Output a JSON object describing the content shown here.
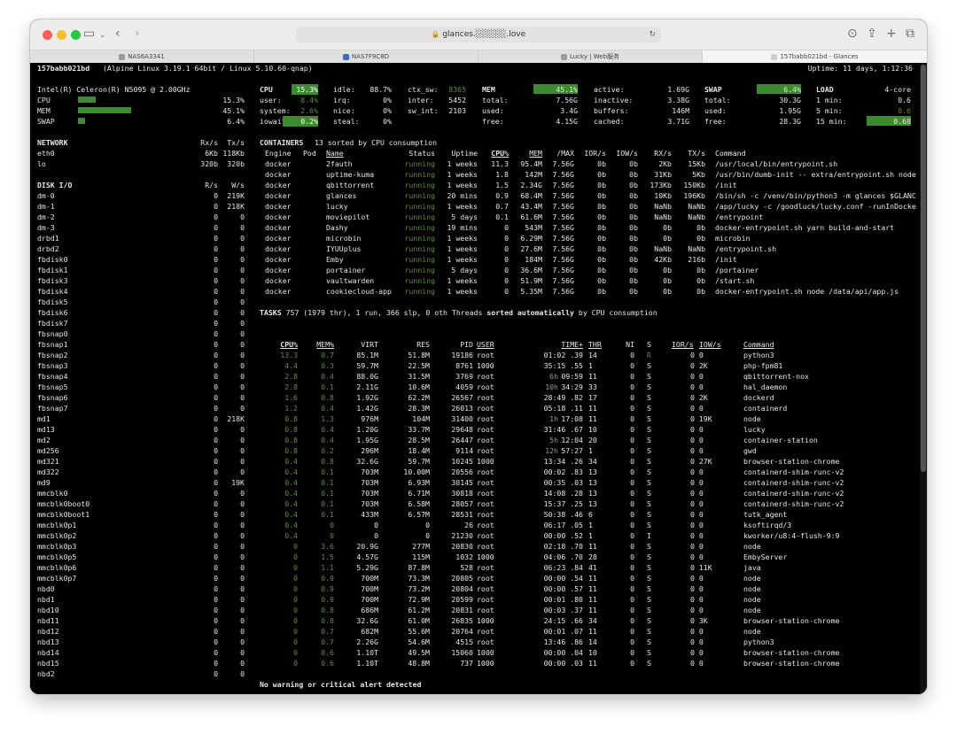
{
  "browser": {
    "address": "glances.░░░░░.love",
    "tabs": [
      "NAS6A3341",
      "NAS7F9C8D",
      "Lucky | Web服务",
      "157babb021bd - Glances"
    ]
  },
  "header": {
    "host": "157babb021bd",
    "os": "(Alpine Linux 3.19.1 64bit / Linux 5.10.60-qnap)",
    "uptime": "Uptime: 11 days, 1:12:36"
  },
  "quicklook": {
    "cpu_name": "Intel(R) Celeron(R) N5095 @ 2.00GHz",
    "rows": [
      {
        "label": "CPU",
        "value": "15.3%",
        "fraction": 0.153
      },
      {
        "label": "MEM",
        "value": "45.1%",
        "fraction": 0.451
      },
      {
        "label": "SWAP",
        "value": "6.4%",
        "fraction": 0.064
      }
    ]
  },
  "cpu": {
    "title": "CPU",
    "total": "15.3%",
    "c1": [
      [
        "user:",
        "8.4%"
      ],
      [
        "system:",
        "2.6%"
      ],
      [
        "iowait:",
        "0.2%"
      ]
    ],
    "c2": [
      [
        "idle:",
        "88.7%"
      ],
      [
        "irq:",
        "0%"
      ],
      [
        "nice:",
        "0%"
      ],
      [
        "steal:",
        "0%"
      ]
    ],
    "c3": [
      [
        "ctx_sw:",
        "8365"
      ],
      [
        "inter:",
        "5452"
      ],
      [
        "sw_int:",
        "2103"
      ]
    ]
  },
  "mem": {
    "title": "MEM",
    "total": "45.1%",
    "c1": [
      [
        "total:",
        "7.56G"
      ],
      [
        "used:",
        "3.4G"
      ],
      [
        "free:",
        "4.15G"
      ]
    ],
    "c2": [
      [
        "active:",
        "1.69G"
      ],
      [
        "inactive:",
        "3.38G"
      ],
      [
        "buffers:",
        "146M"
      ],
      [
        "cached:",
        "3.71G"
      ]
    ]
  },
  "swap": {
    "title": "SWAP",
    "total": "6.4%",
    "rows": [
      [
        "total:",
        "30.3G"
      ],
      [
        "used:",
        "1.95G"
      ],
      [
        "free:",
        "28.3G"
      ]
    ]
  },
  "load": {
    "title": "LOAD",
    "cores": "4-core",
    "rows": [
      [
        "1 min:",
        "0.6"
      ],
      [
        "5 min:",
        "0.6"
      ],
      [
        "15 min:",
        "0.68"
      ]
    ]
  },
  "network": {
    "title": "NETWORK",
    "rx": "Rx/s",
    "tx": "Tx/s",
    "rows": [
      [
        "eth0",
        "6Kb",
        "118Kb"
      ],
      [
        "lo",
        "320b",
        "320b"
      ]
    ]
  },
  "diskio": {
    "title": "DISK I/O",
    "r": "R/s",
    "w": "W/s",
    "rows": [
      [
        "dm-0",
        "0",
        "219K"
      ],
      [
        "dm-1",
        "0",
        "218K"
      ],
      [
        "dm-2",
        "0",
        "0"
      ],
      [
        "dm-3",
        "0",
        "0"
      ],
      [
        "drbd1",
        "0",
        "0"
      ],
      [
        "drbd2",
        "0",
        "0"
      ],
      [
        "fbdisk0",
        "0",
        "0"
      ],
      [
        "fbdisk1",
        "0",
        "0"
      ],
      [
        "fbdisk3",
        "0",
        "0"
      ],
      [
        "fbdisk4",
        "0",
        "0"
      ],
      [
        "fbdisk5",
        "0",
        "0"
      ],
      [
        "fbdisk6",
        "0",
        "0"
      ],
      [
        "fbdisk7",
        "0",
        "0"
      ],
      [
        "fbsnap0",
        "0",
        "0"
      ],
      [
        "fbsnap1",
        "0",
        "0"
      ],
      [
        "fbsnap2",
        "0",
        "0"
      ],
      [
        "fbsnap3",
        "0",
        "0"
      ],
      [
        "fbsnap4",
        "0",
        "0"
      ],
      [
        "fbsnap5",
        "0",
        "0"
      ],
      [
        "fbsnap6",
        "0",
        "0"
      ],
      [
        "fbsnap7",
        "0",
        "0"
      ],
      [
        "md1",
        "0",
        "218K"
      ],
      [
        "md13",
        "0",
        "0"
      ],
      [
        "md2",
        "0",
        "0"
      ],
      [
        "md256",
        "0",
        "0"
      ],
      [
        "md321",
        "0",
        "0"
      ],
      [
        "md322",
        "0",
        "0"
      ],
      [
        "md9",
        "0",
        "19K"
      ],
      [
        "mmcblk0",
        "0",
        "0"
      ],
      [
        "mmcblk0boot0",
        "0",
        "0"
      ],
      [
        "mmcblk0boot1",
        "0",
        "0"
      ],
      [
        "mmcblk0p1",
        "0",
        "0"
      ],
      [
        "mmcblk0p2",
        "0",
        "0"
      ],
      [
        "mmcblk0p3",
        "0",
        "0"
      ],
      [
        "mmcblk0p5",
        "0",
        "0"
      ],
      [
        "mmcblk0p6",
        "0",
        "0"
      ],
      [
        "mmcblk0p7",
        "0",
        "0"
      ],
      [
        "nbd0",
        "0",
        "0"
      ],
      [
        "nbd1",
        "0",
        "0"
      ],
      [
        "nbd10",
        "0",
        "0"
      ],
      [
        "nbd11",
        "0",
        "0"
      ],
      [
        "nbd12",
        "0",
        "0"
      ],
      [
        "nbd13",
        "0",
        "0"
      ],
      [
        "nbd14",
        "0",
        "0"
      ],
      [
        "nbd15",
        "0",
        "0"
      ],
      [
        "nbd2",
        "0",
        "0"
      ]
    ]
  },
  "containers": {
    "title": "CONTAINERS",
    "subtitle": "13 sorted by CPU consumption",
    "headers": [
      "Engine",
      "Pod",
      "Name",
      "Status",
      "Uptime",
      "CPU%",
      "MEM",
      "/MAX",
      "IOR/s",
      "IOW/s",
      "RX/s",
      "TX/s",
      "Command"
    ],
    "rows": [
      [
        "docker",
        "",
        "2fauth",
        "running",
        "1 weeks",
        "11.3",
        "95.4M",
        "7.56G",
        "0b",
        "0b",
        "2Kb",
        "15Kb",
        "/usr/local/bin/entrypoint.sh"
      ],
      [
        "docker",
        "",
        "uptime-kuma",
        "running",
        "1 weeks",
        "1.8",
        "142M",
        "7.56G",
        "0b",
        "0b",
        "31Kb",
        "5Kb",
        "/usr/bin/dumb-init -- extra/entrypoint.sh node"
      ],
      [
        "docker",
        "",
        "qbittorrent",
        "running",
        "1 weeks",
        "1.5",
        "2.34G",
        "7.56G",
        "0b",
        "0b",
        "173Kb",
        "150Kb",
        "/init"
      ],
      [
        "docker",
        "",
        "glances",
        "running",
        "20 mins",
        "0.9",
        "68.4M",
        "7.56G",
        "0b",
        "0b",
        "10Kb",
        "196Kb",
        "/bin/sh -c /venv/bin/python3 -m glances $GLANC"
      ],
      [
        "docker",
        "",
        "lucky",
        "running",
        "1 weeks",
        "0.7",
        "43.4M",
        "7.56G",
        "0b",
        "0b",
        "NaNb",
        "NaNb",
        "/app/lucky -c /goodluck/lucky.conf -runInDocke"
      ],
      [
        "docker",
        "",
        "moviepilot",
        "running",
        "5 days",
        "0.1",
        "61.6M",
        "7.56G",
        "0b",
        "0b",
        "NaNb",
        "NaNb",
        "/entrypoint"
      ],
      [
        "docker",
        "",
        "Dashy",
        "running",
        "19 mins",
        "0",
        "543M",
        "7.56G",
        "0b",
        "0b",
        "0b",
        "0b",
        "docker-entrypoint.sh yarn build-and-start"
      ],
      [
        "docker",
        "",
        "microbin",
        "running",
        "1 weeks",
        "0",
        "6.29M",
        "7.56G",
        "0b",
        "0b",
        "0b",
        "0b",
        "microbin"
      ],
      [
        "docker",
        "",
        "IYUUplus",
        "running",
        "1 weeks",
        "0",
        "27.6M",
        "7.56G",
        "0b",
        "0b",
        "NaNb",
        "NaNb",
        "/entrypoint.sh"
      ],
      [
        "docker",
        "",
        "Emby",
        "running",
        "1 weeks",
        "0",
        "184M",
        "7.56G",
        "0b",
        "0b",
        "42Kb",
        "216b",
        "/init"
      ],
      [
        "docker",
        "",
        "portainer",
        "running",
        "5 days",
        "0",
        "36.6M",
        "7.56G",
        "0b",
        "0b",
        "0b",
        "0b",
        "/portainer"
      ],
      [
        "docker",
        "",
        "vaultwarden",
        "running",
        "1 weeks",
        "0",
        "51.9M",
        "7.56G",
        "0b",
        "0b",
        "0b",
        "0b",
        "/start.sh"
      ],
      [
        "docker",
        "",
        "cookiecloud-app",
        "running",
        "1 weeks",
        "0",
        "5.35M",
        "7.56G",
        "0b",
        "0b",
        "0b",
        "0b",
        "docker-entrypoint.sh node /data/api/app.js"
      ]
    ]
  },
  "tasks": {
    "label": "TASKS",
    "summary": "757 (1979 thr), 1 run, 366 slp, 0 oth Threads",
    "sorted": "sorted automatically",
    "by": "by CPU consumption"
  },
  "processes": {
    "headers": [
      "CPU%",
      "MEM%",
      "VIRT",
      "RES",
      "PID",
      "USER",
      "TIME+",
      "THR",
      "NI",
      "S",
      "IOR/s",
      "IOW/s",
      "Command"
    ],
    "rows": [
      [
        "13.3",
        "0.7",
        "85.1M",
        "51.8M",
        "19186",
        "root",
        "",
        "01:02 .39",
        "14",
        "0",
        "R",
        "0 0",
        "python3"
      ],
      [
        "4.4",
        "0.3",
        "59.7M",
        "22.5M",
        "8761",
        "1000",
        "",
        "35:15 .55",
        "1",
        "0",
        "S",
        "0 2K",
        "php-fpm81"
      ],
      [
        "2.8",
        "0.4",
        "88.0G",
        "31.5M",
        "3769",
        "root",
        "6h",
        "09:59",
        "11",
        "0",
        "S",
        "0 0",
        "qbittorrent-nox"
      ],
      [
        "2.8",
        "0.1",
        "2.11G",
        "10.6M",
        "4059",
        "root",
        "10h",
        "34:29",
        "33",
        "0",
        "S",
        "0 0",
        "hal_daemon"
      ],
      [
        "1.6",
        "0.8",
        "1.92G",
        "62.2M",
        "26567",
        "root",
        "",
        "28:49 .82",
        "17",
        "0",
        "S",
        "0 2K",
        "dockerd"
      ],
      [
        "1.2",
        "0.4",
        "1.42G",
        "28.3M",
        "26013",
        "root",
        "",
        "05:18 .11",
        "11",
        "0",
        "S",
        "0 0",
        "containerd"
      ],
      [
        "0.8",
        "1.3",
        "976M",
        "104M",
        "31400",
        "root",
        "1h",
        "17:08",
        "11",
        "0",
        "S",
        "0 19K",
        "node"
      ],
      [
        "0.8",
        "0.4",
        "1.20G",
        "33.7M",
        "29648",
        "root",
        "",
        "31:46 .67",
        "10",
        "0",
        "S",
        "0 0",
        "lucky"
      ],
      [
        "0.8",
        "0.4",
        "1.95G",
        "28.5M",
        "26447",
        "root",
        "5h",
        "12:04",
        "20",
        "0",
        "S",
        "0 0",
        "container-station"
      ],
      [
        "0.8",
        "0.2",
        "296M",
        "18.4M",
        "9114",
        "root",
        "12h",
        "57:27",
        "1",
        "0",
        "S",
        "0 0",
        "gwd"
      ],
      [
        "0.4",
        "0.8",
        "32.6G",
        "59.7M",
        "10245",
        "1000",
        "",
        "13:34 .26",
        "34",
        "0",
        "S",
        "0 27K",
        "browser-station-chrome"
      ],
      [
        "0.4",
        "0.1",
        "703M",
        "10.00M",
        "20556",
        "root",
        "",
        "00:02 .83",
        "13",
        "0",
        "S",
        "0 0",
        "containerd-shim-runc-v2"
      ],
      [
        "0.4",
        "0.1",
        "703M",
        "6.93M",
        "30145",
        "root",
        "",
        "00:35 .03",
        "13",
        "0",
        "S",
        "0 0",
        "containerd-shim-runc-v2"
      ],
      [
        "0.4",
        "0.1",
        "703M",
        "6.71M",
        "30818",
        "root",
        "",
        "14:08 .28",
        "13",
        "0",
        "S",
        "0 0",
        "containerd-shim-runc-v2"
      ],
      [
        "0.4",
        "0.1",
        "703M",
        "6.58M",
        "28057",
        "root",
        "",
        "15:37 .25",
        "13",
        "0",
        "S",
        "0 0",
        "containerd-shim-runc-v2"
      ],
      [
        "0.4",
        "0.1",
        "433M",
        "6.57M",
        "28531",
        "root",
        "",
        "50:38 .46",
        "6",
        "0",
        "S",
        "0 0",
        "tutk_agent"
      ],
      [
        "0.4",
        "0",
        "0",
        "0",
        "26",
        "root",
        "",
        "06:17 .05",
        "1",
        "0",
        "S",
        "0 0",
        "ksoftirqd/3"
      ],
      [
        "0.4",
        "0",
        "0",
        "0",
        "21230",
        "root",
        "",
        "00:00 .52",
        "1",
        "0",
        "I",
        "0 0",
        "kworker/u8:4-flush-9:9"
      ],
      [
        "0",
        "3.6",
        "20.9G",
        "277M",
        "20830",
        "root",
        "",
        "02:18 .70",
        "11",
        "0",
        "S",
        "0 0",
        "node"
      ],
      [
        "0",
        "1.5",
        "4.57G",
        "115M",
        "1032",
        "1000",
        "",
        "04:06 .70",
        "28",
        "0",
        "S",
        "0 0",
        "EmbyServer"
      ],
      [
        "0",
        "1.1",
        "5.29G",
        "87.8M",
        "528",
        "root",
        "",
        "06:23 .84",
        "41",
        "0",
        "S",
        "0 11K",
        "java"
      ],
      [
        "0",
        "0.9",
        "700M",
        "73.3M",
        "20805",
        "root",
        "",
        "00:00 .54",
        "11",
        "0",
        "S",
        "0 0",
        "node"
      ],
      [
        "0",
        "0.9",
        "700M",
        "73.2M",
        "20804",
        "root",
        "",
        "00:00 .57",
        "11",
        "0",
        "S",
        "0 0",
        "node"
      ],
      [
        "0",
        "0.9",
        "700M",
        "72.9M",
        "20599",
        "root",
        "",
        "00:01 .80",
        "11",
        "0",
        "S",
        "0 0",
        "node"
      ],
      [
        "0",
        "0.8",
        "686M",
        "61.2M",
        "20831",
        "root",
        "",
        "00:03 .37",
        "11",
        "0",
        "S",
        "0 0",
        "node"
      ],
      [
        "0",
        "0.8",
        "32.6G",
        "61.0M",
        "26835",
        "1000",
        "",
        "24:15 .66",
        "34",
        "0",
        "S",
        "0 3K",
        "browser-station-chrome"
      ],
      [
        "0",
        "0.7",
        "682M",
        "55.6M",
        "20764",
        "root",
        "",
        "00:01 .07",
        "11",
        "0",
        "S",
        "0 0",
        "node"
      ],
      [
        "0",
        "0.7",
        "2.26G",
        "54.6M",
        "4515",
        "root",
        "",
        "13:46 .86",
        "14",
        "0",
        "S",
        "0 0",
        "python3"
      ],
      [
        "0",
        "0.6",
        "1.10T",
        "49.5M",
        "15060",
        "1000",
        "",
        "00:00 .04",
        "10",
        "0",
        "S",
        "0 0",
        "browser-station-chrome"
      ],
      [
        "0",
        "0.6",
        "1.10T",
        "48.8M",
        "737",
        "1000",
        "",
        "00:00 .03",
        "11",
        "0",
        "S",
        "0 0",
        "browser-station-chrome"
      ]
    ]
  },
  "alert": "No warning or critical alert detected",
  "colors": {
    "accent": "#3b8c2a",
    "ok_text": "#6fc63c",
    "background": "#000000"
  }
}
